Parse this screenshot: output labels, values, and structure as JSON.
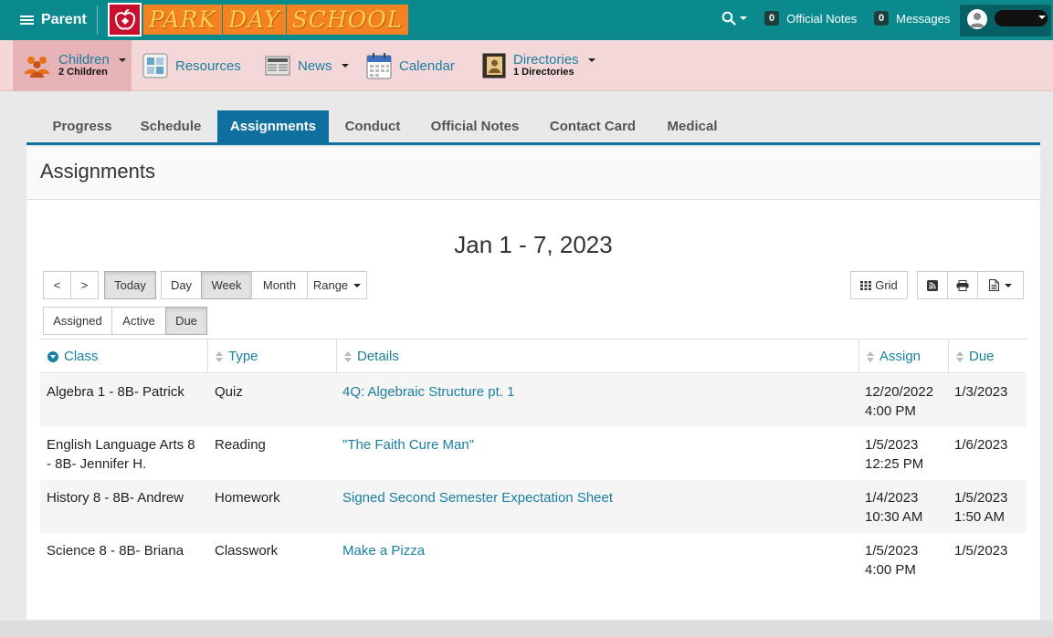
{
  "topbar": {
    "role_label": "Parent",
    "logo_words": [
      "PARK",
      "DAY",
      "SCHOOL"
    ],
    "official_notes": {
      "count": "0",
      "label": "Official Notes"
    },
    "messages": {
      "count": "0",
      "label": "Messages"
    }
  },
  "nav": {
    "children": {
      "label": "Children",
      "sub": "2 Children"
    },
    "resources": {
      "label": "Resources"
    },
    "news": {
      "label": "News"
    },
    "calendar": {
      "label": "Calendar"
    },
    "directories": {
      "label": "Directories",
      "sub": "1 Directories"
    }
  },
  "tabs": [
    "Progress",
    "Schedule",
    "Assignments",
    "Conduct",
    "Official Notes",
    "Contact Card",
    "Medical"
  ],
  "page_title": "Assignments",
  "date_range": "Jan 1 - 7, 2023",
  "toolbar": {
    "prev": "<",
    "next": ">",
    "today": "Today",
    "day": "Day",
    "week": "Week",
    "month": "Month",
    "range": "Range",
    "grid": "Grid"
  },
  "filters": {
    "assigned": "Assigned",
    "active": "Active",
    "due": "Due"
  },
  "table": {
    "headers": {
      "class": "Class",
      "type": "Type",
      "details": "Details",
      "assign": "Assign",
      "due": "Due"
    },
    "rows": [
      {
        "class": [
          "Algebra 1 - 8B- Patrick",
          ""
        ],
        "type": "Quiz",
        "details": "4Q: Algebraic Structure pt. 1",
        "assign": [
          "12/20/2022",
          "4:00 PM"
        ],
        "due": [
          "1/3/2023",
          ""
        ]
      },
      {
        "class": [
          "English Language Arts 8",
          "- 8B- Jennifer H."
        ],
        "type": "Reading",
        "details": "\"The Faith Cure Man\"",
        "assign": [
          "1/5/2023",
          "12:25 PM"
        ],
        "due": [
          "1/6/2023",
          ""
        ]
      },
      {
        "class": [
          "History 8 - 8B- Andrew",
          ""
        ],
        "type": "Homework",
        "details": "Signed Second Semester Expectation Sheet",
        "assign": [
          "1/4/2023",
          "10:30 AM"
        ],
        "due": [
          "1/5/2023",
          "1:50 AM"
        ]
      },
      {
        "class": [
          "Science 8 - 8B- Briana",
          ""
        ],
        "type": "Classwork",
        "details": "Make a Pizza",
        "assign": [
          "1/5/2023",
          "4:00 PM"
        ],
        "due": [
          "1/5/2023",
          ""
        ]
      }
    ]
  }
}
